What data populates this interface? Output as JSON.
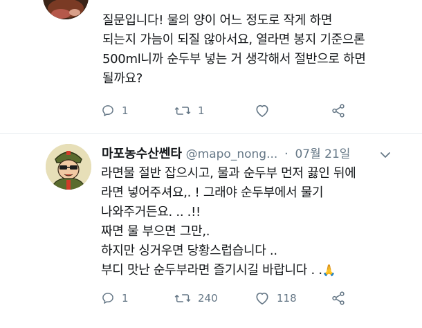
{
  "previous_tweet": {
    "text_lines": [
      "질문입니다! 물의 양이 어느 정도로 작게 하면",
      "되는지 가늠이 되질 않아서요, 열라면 봉지 기준으론",
      "500ml니까 순두부 넣는 거 생각해서 절반으로 하면",
      "될까요?"
    ],
    "actions": {
      "reply_count": "1",
      "retweet_count": "1",
      "like_count": "",
      "share_label": ""
    }
  },
  "reply_tweet": {
    "display_name": "마포농수산쎈타",
    "handle": "@mapo_nong...",
    "separator": "·",
    "timestamp": "07월 21일",
    "text_lines": [
      "라면물 절반 잡으시고, 물과 순두부 먼저 끓인 뒤에",
      "라면 넣어주셔요,. ! 그래야 순두부에서 물기",
      "나와주거든요. .. .!!",
      "짜면 물 부으면 그만,.",
      "하지만 싱거우면 당황스럽습니다 ..",
      "부디 맛난 순두부라면 즐기시길 바랍니다 . ."
    ],
    "emoji": "🙏",
    "actions": {
      "reply_count": "1",
      "retweet_count": "240",
      "like_count": "118"
    }
  },
  "icons": {
    "reply": "reply-icon",
    "retweet": "retweet-icon",
    "like": "heart-icon",
    "share": "share-icon",
    "more": "chevron-down-icon"
  },
  "colors": {
    "text": "#14171a",
    "secondary": "#657786",
    "thread_line": "#ccd6dd",
    "divider": "#e6ecf0"
  }
}
